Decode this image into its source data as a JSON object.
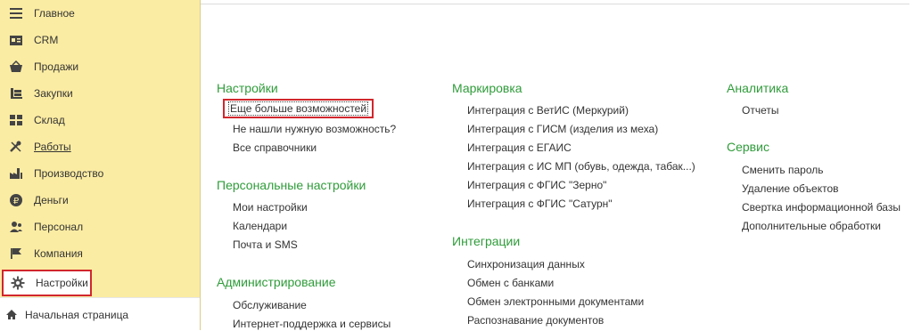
{
  "sidebar": {
    "items": [
      {
        "label": "Главное",
        "icon": "menu-lines-icon"
      },
      {
        "label": "CRM",
        "icon": "crm-card-icon"
      },
      {
        "label": "Продажи",
        "icon": "basket-icon"
      },
      {
        "label": "Закупки",
        "icon": "cart-icon"
      },
      {
        "label": "Склад",
        "icon": "warehouse-grid-icon"
      },
      {
        "label": "Работы",
        "icon": "tools-icon"
      },
      {
        "label": "Производство",
        "icon": "factory-icon"
      },
      {
        "label": "Деньги",
        "icon": "ruble-coin-icon"
      },
      {
        "label": "Персонал",
        "icon": "people-icon"
      },
      {
        "label": "Компания",
        "icon": "flag-icon"
      },
      {
        "label": "Настройки",
        "icon": "gear-icon"
      }
    ],
    "home_label": "Начальная страница"
  },
  "columns": {
    "col1": {
      "sections": [
        {
          "title": "Настройки",
          "links": [
            "Еще больше возможностей",
            "Не нашли нужную возможность?",
            "Все справочники"
          ]
        },
        {
          "title": "Персональные настройки",
          "links": [
            "Мои настройки",
            "Календари",
            "Почта и SMS"
          ]
        },
        {
          "title": "Администрирование",
          "links": [
            "Обслуживание",
            "Интернет-поддержка и сервисы"
          ]
        }
      ]
    },
    "col2": {
      "sections": [
        {
          "title": "Маркировка",
          "links": [
            "Интеграция с ВетИС (Меркурий)",
            "Интеграция с ГИСМ (изделия из меха)",
            "Интеграция с ЕГАИС",
            "Интеграция с ИС МП (обувь, одежда, табак...)",
            "Интеграция с ФГИС \"Зерно\"",
            "Интеграция с ФГИС \"Сатурн\""
          ]
        },
        {
          "title": "Интеграции",
          "links": [
            "Синхронизация данных",
            "Обмен с банками",
            "Обмен электронными документами",
            "Распознавание документов"
          ]
        }
      ]
    },
    "col3": {
      "sections": [
        {
          "title": "Аналитика",
          "links": [
            "Отчеты"
          ]
        },
        {
          "title": "Сервис",
          "links": [
            "Сменить пароль",
            "Удаление объектов",
            "Свертка информационной базы",
            "Дополнительные обработки"
          ]
        }
      ]
    }
  },
  "colors": {
    "accent_green": "#2f9c3a",
    "sidebar_bg": "#fbeca3",
    "highlight_red": "#d1262c"
  }
}
